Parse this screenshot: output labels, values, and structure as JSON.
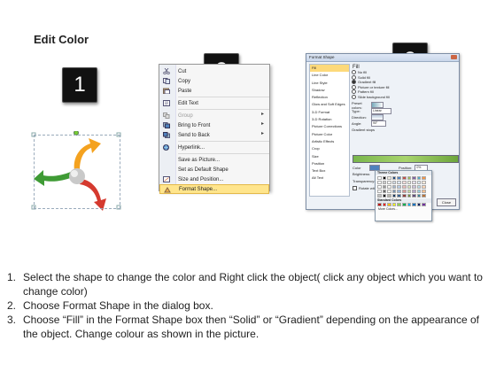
{
  "title": "Edit Color",
  "steps": [
    "1",
    "2",
    "3"
  ],
  "context_menu": {
    "items": [
      {
        "label": "Cut",
        "icon": "scissors-icon",
        "disabled": false
      },
      {
        "label": "Copy",
        "icon": "copy-icon",
        "disabled": false
      },
      {
        "label": "Paste",
        "icon": "paste-icon",
        "disabled": false
      },
      {
        "label": "Edit Text",
        "icon": "edit-text-icon",
        "disabled": false
      },
      {
        "label": "Group",
        "icon": "group-icon",
        "disabled": true,
        "submenu": true
      },
      {
        "label": "Bring to Front",
        "icon": "bring-front-icon",
        "disabled": false,
        "submenu": true
      },
      {
        "label": "Send to Back",
        "icon": "send-back-icon",
        "disabled": false,
        "submenu": true
      },
      {
        "label": "Hyperlink...",
        "icon": "hyperlink-icon",
        "disabled": false
      },
      {
        "label": "Save as Picture...",
        "icon": "",
        "disabled": false
      },
      {
        "label": "Set as Default Shape",
        "icon": "",
        "disabled": false
      },
      {
        "label": "Size and Position...",
        "icon": "size-position-icon",
        "disabled": false
      },
      {
        "label": "Format Shape...",
        "icon": "format-shape-icon",
        "disabled": false,
        "highlighted": true
      }
    ]
  },
  "dialog": {
    "title": "Format Shape",
    "categories": [
      "Fill",
      "Line Color",
      "Line Style",
      "Shadow",
      "Reflection",
      "Glow and Soft Edges",
      "3-D Format",
      "3-D Rotation",
      "Picture Corrections",
      "Picture Color",
      "Artistic Effects",
      "Crop",
      "Size",
      "Position",
      "Text Box",
      "Alt Text"
    ],
    "fill_heading": "Fill",
    "fill_options": [
      "No fill",
      "Solid fill",
      "Gradient fill",
      "Picture or texture fill",
      "Pattern fill",
      "Slide background fill"
    ],
    "selected_fill": 2,
    "fields": [
      {
        "label": "Preset colors:"
      },
      {
        "label": "Type:",
        "value": "Linear"
      },
      {
        "label": "Direction:"
      },
      {
        "label": "Angle:",
        "value": "90°"
      },
      {
        "label": "Gradient stops"
      }
    ],
    "color_label": "Color",
    "position_label": "Position:",
    "position_value": "0%",
    "brightness_label": "Brightness:",
    "transparency_label": "Transparency:",
    "rotate_label": "Rotate with shape",
    "close_label": "Close"
  },
  "palette": {
    "theme_title": "Theme Colors",
    "standard_title": "Standard Colors",
    "more_label": "More Colors...",
    "theme_colors": [
      "#ffffff",
      "#000000",
      "#eeece1",
      "#1f497d",
      "#4f81bd",
      "#c0504d",
      "#9bbb59",
      "#8064a2",
      "#4bacc6",
      "#f79646"
    ],
    "standard_colors": [
      "#c00000",
      "#ff0000",
      "#ffc000",
      "#ffff00",
      "#92d050",
      "#00b050",
      "#00b0f0",
      "#0070c0",
      "#002060",
      "#7030a0"
    ]
  },
  "instructions": [
    {
      "num": "1.",
      "text": "Select the shape to change the color and Right click the object( click any object which you want to change color)"
    },
    {
      "num": "2.",
      "text": "Choose Format Shape in the dialog box."
    },
    {
      "num": "3.",
      "text": "Choose “Fill” in the Format Shape box then “Solid” or “Gradient” depending on the appearance of the object. Change colour as shown in the picture."
    }
  ]
}
